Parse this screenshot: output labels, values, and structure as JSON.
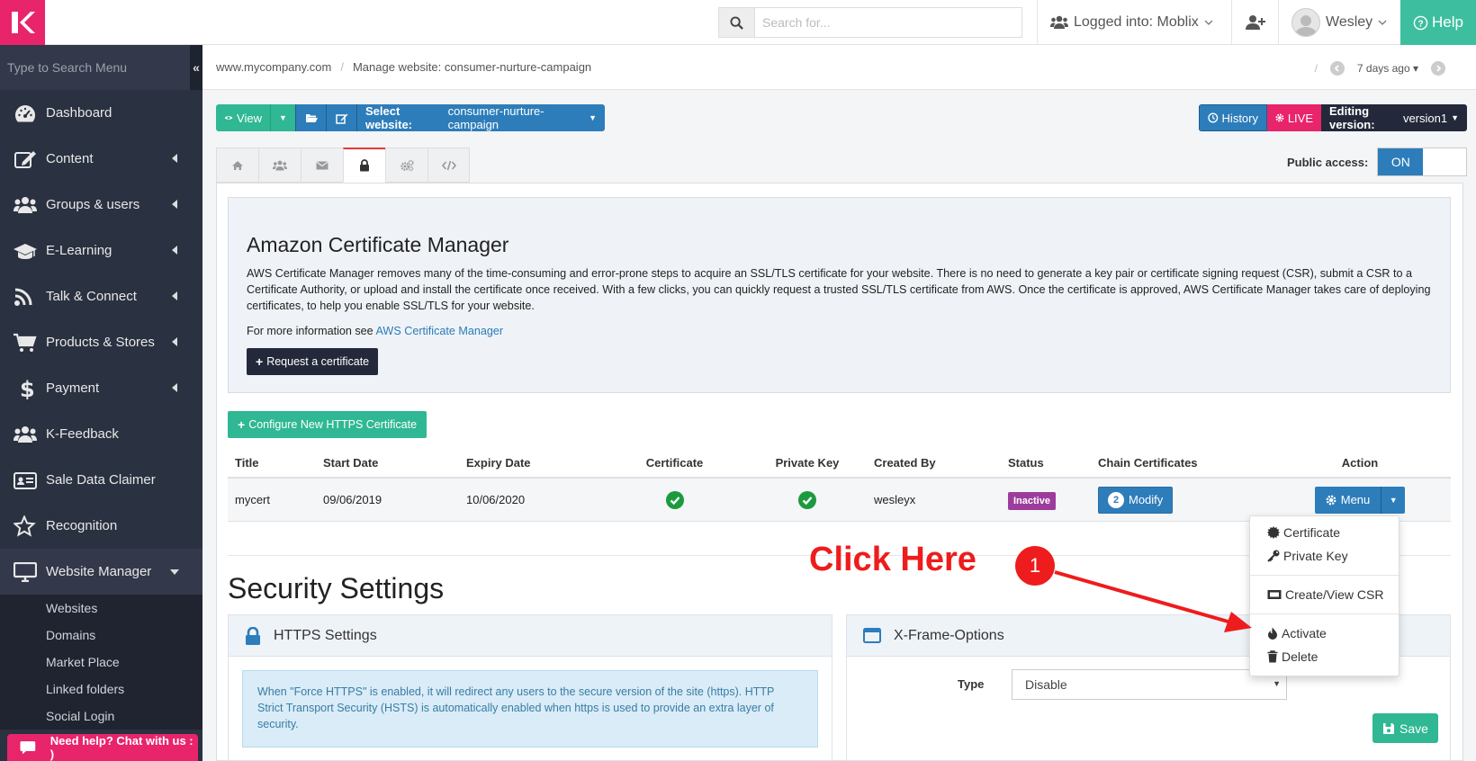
{
  "header": {
    "search_placeholder": "Search for...",
    "logged_into": "Logged into: Moblix",
    "user_name": "Wesley",
    "help_label": "Help"
  },
  "sidebar": {
    "search_placeholder": "Type to Search Menu",
    "items": [
      {
        "label": "Dashboard",
        "icon": "dashboard-icon"
      },
      {
        "label": "Content",
        "icon": "edit-icon"
      },
      {
        "label": "Groups & users",
        "icon": "users-icon"
      },
      {
        "label": "E-Learning",
        "icon": "graduation-cap-icon"
      },
      {
        "label": "Talk & Connect",
        "icon": "rss-icon"
      },
      {
        "label": "Products & Stores",
        "icon": "cart-icon"
      },
      {
        "label": "Payment",
        "icon": "dollar-icon"
      },
      {
        "label": "K-Feedback",
        "icon": "users-icon"
      },
      {
        "label": "Sale Data Claimer",
        "icon": "id-card-icon"
      },
      {
        "label": "Recognition",
        "icon": "star-icon"
      },
      {
        "label": "Website Manager",
        "icon": "monitor-icon"
      }
    ],
    "subitems": [
      "Websites",
      "Domains",
      "Market Place",
      "Linked folders",
      "Social Login"
    ],
    "chat_label": "Need help? Chat with us : )"
  },
  "breadcrumb": {
    "site": "www.mycompany.com",
    "page": "Manage website: consumer-nurture-campaign",
    "version_time": "7 days ago"
  },
  "toolbar": {
    "view_label": "View",
    "select_website_bold": "Select website:",
    "select_website_value": "consumer-nurture-campaign",
    "history_label": "History",
    "live_label": "LIVE",
    "editing_version_bold": "Editing version:",
    "editing_version_value": "version1"
  },
  "public_access": {
    "label": "Public access:",
    "state": "ON"
  },
  "acm": {
    "title": "Amazon Certificate Manager",
    "description": "AWS Certificate Manager removes many of the time-consuming and error-prone steps to acquire an SSL/TLS certificate for your website. There is no need to generate a key pair or certificate signing request (CSR), submit a CSR to a Certificate Authority, or upload and install the certificate once received. With a few clicks, you can quickly request a trusted SSL/TLS certificate from AWS. Once the certificate is approved, AWS Certificate Manager takes care of deploying certificates, to help you enable SSL/TLS for your website.",
    "more_info_prefix": "For more information see",
    "more_info_link": "AWS Certificate Manager",
    "request_label": "Request a certificate"
  },
  "configure_label": "Configure New HTTPS Certificate",
  "table": {
    "headers": [
      "Title",
      "Start Date",
      "Expiry Date",
      "Certificate",
      "Private Key",
      "Created By",
      "Status",
      "Chain Certificates",
      "Action"
    ],
    "row": {
      "title": "mycert",
      "start": "09/06/2019",
      "expiry": "10/06/2020",
      "created_by": "wesleyx",
      "status": "Inactive",
      "chain_count": "2",
      "modify_label": "Modify",
      "menu_label": "Menu"
    }
  },
  "dropdown": {
    "certificate": "Certificate",
    "private_key": "Private Key",
    "csr": "Create/View CSR",
    "activate": "Activate",
    "delete": "Delete"
  },
  "security": {
    "title": "Security Settings",
    "https_title": "HTTPS Settings",
    "https_info": "When \"Force HTTPS\" is enabled, it will redirect any users to the secure version of the site (https). HTTP Strict Transport Security (HSTS) is automatically enabled when https is used to provide an extra layer of security.",
    "xframe_title": "X-Frame-Options",
    "type_label": "Type",
    "type_value": "Disable",
    "save_label": "Save"
  },
  "annotation": {
    "text": "Click Here",
    "number": "1"
  },
  "colors": {
    "brand": "#e8246b",
    "primary": "#2d7dba",
    "success": "#2fb893",
    "sidebar": "#2a3140",
    "annotation": "#ee1c1c"
  }
}
